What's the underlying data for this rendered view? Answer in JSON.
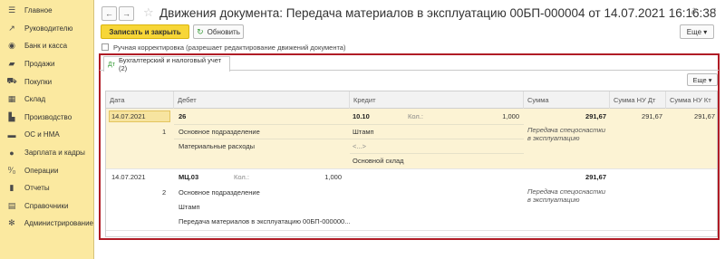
{
  "sidebar": {
    "items": [
      {
        "label": "Главное",
        "icon": "menu-icon"
      },
      {
        "label": "Руководителю",
        "icon": "chart-trend-icon"
      },
      {
        "label": "Банк и касса",
        "icon": "bank-icon"
      },
      {
        "label": "Продажи",
        "icon": "sales-bag-icon"
      },
      {
        "label": "Покупки",
        "icon": "cart-icon"
      },
      {
        "label": "Склад",
        "icon": "warehouse-icon"
      },
      {
        "label": "Производство",
        "icon": "factory-icon"
      },
      {
        "label": "ОС и НМА",
        "icon": "truck-icon"
      },
      {
        "label": "Зарплата и кадры",
        "icon": "person-icon"
      },
      {
        "label": "Операции",
        "icon": "operations-icon"
      },
      {
        "label": "Отчеты",
        "icon": "bar-chart-icon"
      },
      {
        "label": "Справочники",
        "icon": "book-icon"
      },
      {
        "label": "Администрирование",
        "icon": "gear-icon"
      }
    ]
  },
  "header": {
    "title": "Движения документа: Передача материалов в эксплуатацию 00БП-000004 от 14.07.2021 16:16:38",
    "back": "←",
    "forward": "→"
  },
  "toolbar": {
    "save_close": "Записать и закрыть",
    "refresh": "Обновить",
    "more": "Еще ▾"
  },
  "manual_correction": "Ручная корректировка (разрешает редактирование движений документа)",
  "tab_label": "Бухгалтерский и налоговый учет (2)",
  "grid_more": "Еще ▾",
  "grid": {
    "headers": {
      "date": "Дата",
      "debit": "Дебет",
      "credit": "Кредит",
      "sum": "Сумма",
      "sum_nu_dt": "Сумма НУ Дт",
      "sum_nu_kt": "Сумма НУ Кт"
    },
    "rows": [
      {
        "date": "14.07.2021",
        "num": "1",
        "debit_account": "26",
        "debit_sub1": "Основное подразделение",
        "debit_sub2": "Материальные расходы",
        "credit_account": "10.10",
        "credit_qty_label": "Кол.:",
        "credit_qty": "1,000",
        "credit_sub1": "Штамп",
        "credit_sub2": "<...>",
        "credit_sub3": "Основной склад",
        "sum": "291,67",
        "content": "Передача спецоснастки в эксплуатацию",
        "sum_nu_dt": "291,67",
        "sum_nu_kt": "291,67"
      },
      {
        "date": "14.07.2021",
        "num": "2",
        "debit_account": "МЦ.03",
        "debit_qty_label": "Кол.:",
        "debit_qty": "1,000",
        "debit_sub1": "Основное подразделение",
        "debit_sub2": "Штамп",
        "debit_sub3": "Передача материалов в эксплуатацию 00БП-000000...",
        "sum": "291,67",
        "content": "Передача спецоснастки в эксплуатацию"
      }
    ]
  },
  "colors": {
    "sidebar_bg": "#fbe9a0",
    "primary_button": "#f7d637",
    "frame_red": "#b01c26",
    "selected_row": "#fcf3d4"
  }
}
